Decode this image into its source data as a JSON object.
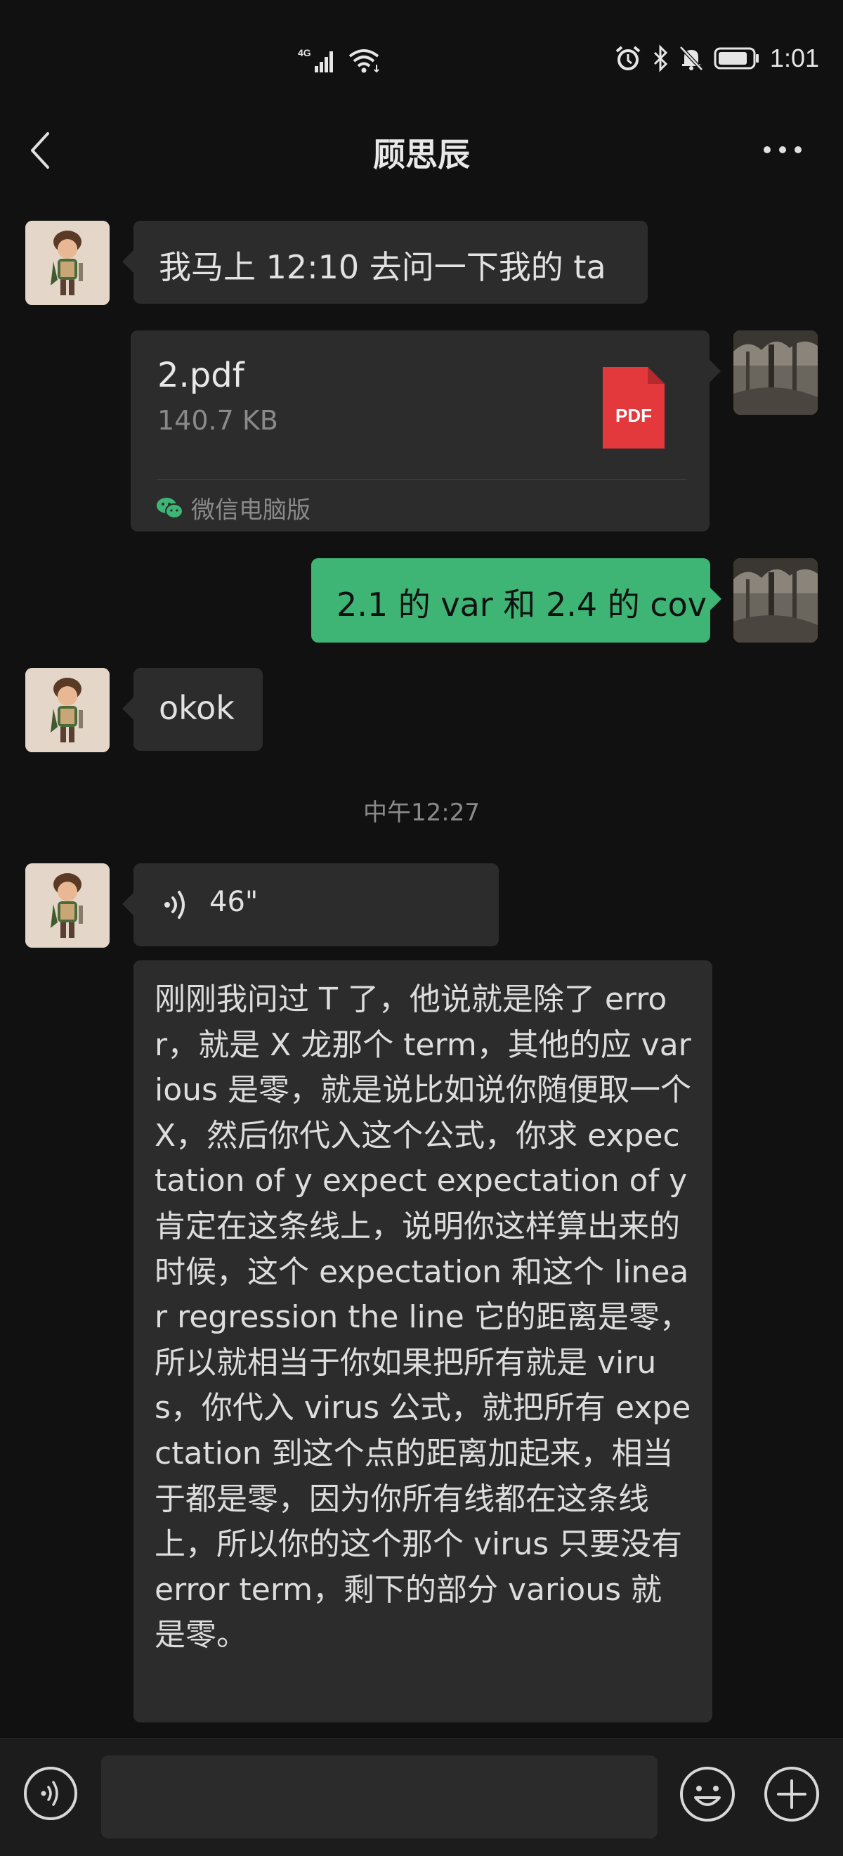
{
  "status_bar": {
    "network": "4G",
    "time": "1:01"
  },
  "header": {
    "title": "顾思辰"
  },
  "messages": {
    "m1_text": "我马上 12:10 去问一下我的 ta",
    "file_name": "2.pdf",
    "file_size": "140.7 KB",
    "file_badge": "PDF",
    "file_source": "微信电脑版",
    "m3_text": "2.1 的 var 和 2.4 的 cov",
    "m4_text": "okok",
    "timestamp": "中午12:27",
    "voice_duration": "46\"",
    "transcript": "刚刚我问过 T 了，他说就是除了 error，就是 X 龙那个 term，其他的应 various 是零，就是说比如说你随便取一个 X，然后你代入这个公式，你求 expectation of y expect expectation of y 肯定在这条线上，说明你这样算出来的时候，这个 expectation 和这个 linear regression the line 它的距离是零，所以就相当于你如果把所有就是 virus，你代入 virus 公式，就把所有 expectation 到这个点的距离加起来，相当于都是零，因为你所有线都在这条线上，所以你的这个那个 virus 只要没有 error term，剩下的部分 various 就是零。"
  },
  "colors": {
    "background": "#111111",
    "bubble_incoming": "#2c2c2c",
    "bubble_outgoing": "#3eb575",
    "pdf_red": "#e4393c"
  }
}
